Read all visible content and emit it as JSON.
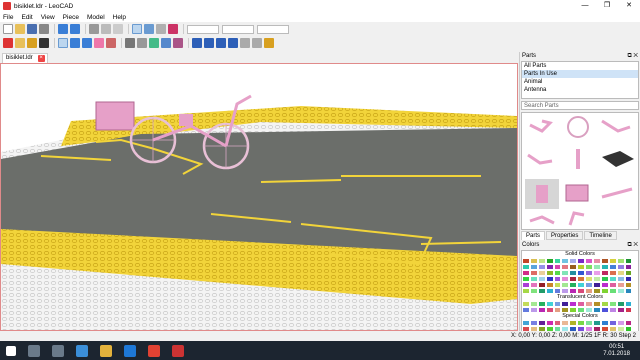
{
  "window": {
    "title": "bisiklet.ldr - LeoCAD",
    "controls": [
      "—",
      "❐",
      "✕"
    ]
  },
  "menu": [
    "File",
    "Edit",
    "View",
    "Piece",
    "Model",
    "Help"
  ],
  "document_tab": {
    "label": "bisiklet.ldr",
    "close": "×"
  },
  "parts_panel": {
    "header": "Parts",
    "header_buttons": "⧉ ✕",
    "categories": [
      "All Parts",
      "Parts In Use",
      "Animal",
      "Antenna"
    ],
    "selected_category": 1,
    "search_placeholder": "Search Parts",
    "tabs": [
      "Parts",
      "Properties",
      "Timeline"
    ]
  },
  "colors_panel": {
    "header": "Colors",
    "header_buttons": "⧉ ✕",
    "solid_label": "Solid Colors",
    "translucent_label": "Translucent Colors",
    "special_label": "Special Colors"
  },
  "status": {
    "right": "X: 0,00 Y: 0,00 Z: 0,00  M: 1/25 1F R: 30  Step 2"
  },
  "taskbar": {
    "time": "00:51",
    "date": "7.01.2018"
  },
  "theme": {
    "pink": "#e6a0c8",
    "yellow": "#f2d43a",
    "road": "#6b6e6a",
    "accent": "#d33"
  }
}
